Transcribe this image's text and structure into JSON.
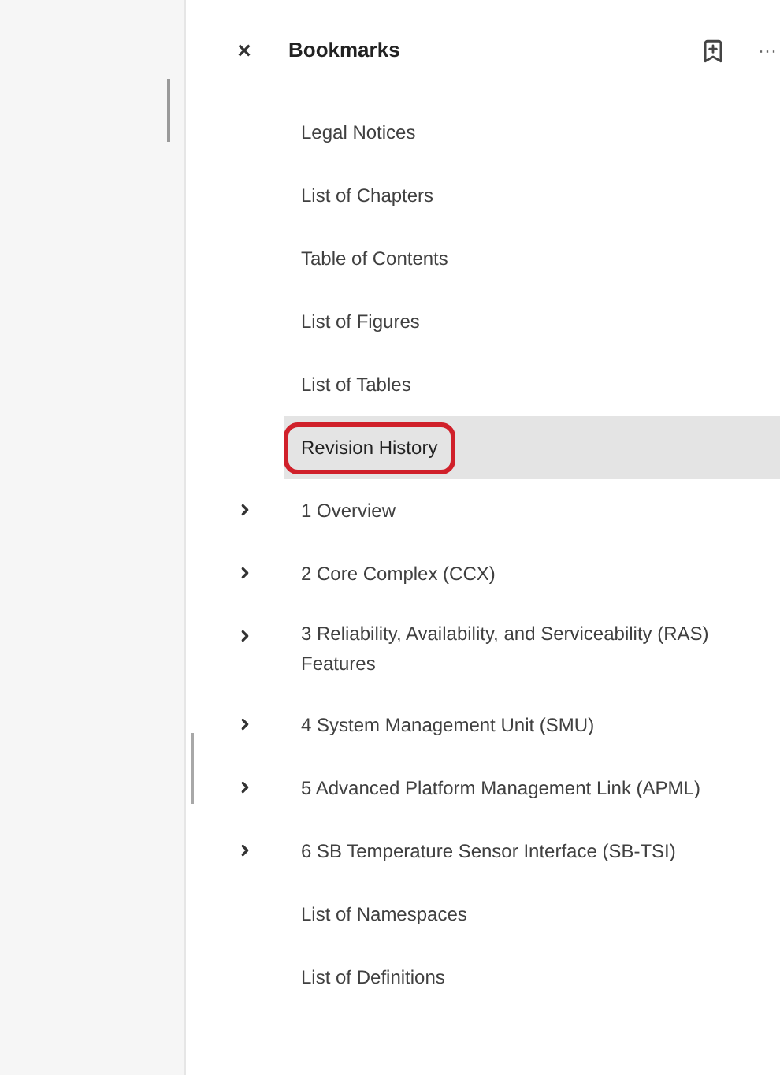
{
  "panel": {
    "title": "Bookmarks",
    "close_label": "×",
    "more_label": "···"
  },
  "bookmarks": [
    {
      "label": "Legal Notices",
      "expandable": false,
      "selected": false,
      "annotated": false
    },
    {
      "label": "List of Chapters",
      "expandable": false,
      "selected": false,
      "annotated": false
    },
    {
      "label": "Table of Contents",
      "expandable": false,
      "selected": false,
      "annotated": false
    },
    {
      "label": "List of Figures",
      "expandable": false,
      "selected": false,
      "annotated": false
    },
    {
      "label": "List of Tables",
      "expandable": false,
      "selected": false,
      "annotated": false
    },
    {
      "label": "Revision History",
      "expandable": false,
      "selected": true,
      "annotated": true
    },
    {
      "label": "1 Overview",
      "expandable": true,
      "selected": false,
      "annotated": false
    },
    {
      "label": "2 Core Complex (CCX)",
      "expandable": true,
      "selected": false,
      "annotated": false
    },
    {
      "label": "3 Reliability, Availability, and Serviceability (RAS) Features",
      "expandable": true,
      "selected": false,
      "annotated": false
    },
    {
      "label": "4 System Management Unit (SMU)",
      "expandable": true,
      "selected": false,
      "annotated": false
    },
    {
      "label": "5 Advanced Platform Management Link (APML)",
      "expandable": true,
      "selected": false,
      "annotated": false
    },
    {
      "label": "6 SB Temperature Sensor Interface (SB-TSI)",
      "expandable": true,
      "selected": false,
      "annotated": false
    },
    {
      "label": "List of Namespaces",
      "expandable": false,
      "selected": false,
      "annotated": false
    },
    {
      "label": "List of Definitions",
      "expandable": false,
      "selected": false,
      "annotated": false
    }
  ]
}
